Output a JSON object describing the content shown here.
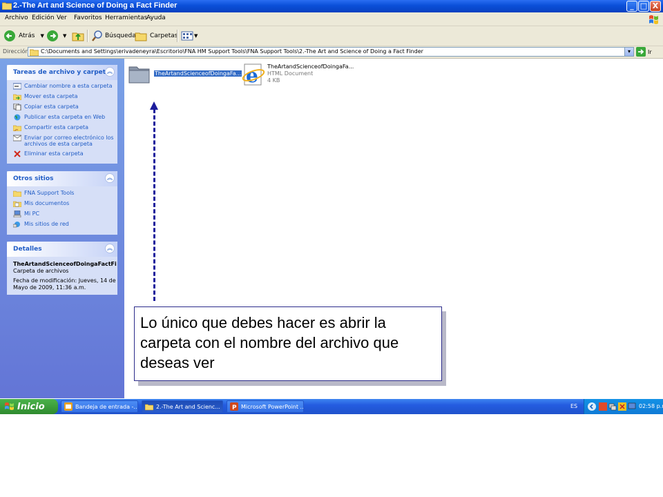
{
  "window": {
    "title": "2.-The Art and Science of Doing a Fact Finder",
    "minimize": "_",
    "maximize": "□",
    "close": "X"
  },
  "menu": [
    "Archivo",
    "Edición",
    "Ver",
    "Favoritos",
    "Herramientas",
    "Ayuda"
  ],
  "toolbar": {
    "back": "Atrás",
    "search": "Búsqueda",
    "folders": "Carpetas"
  },
  "address": {
    "label": "Dirección",
    "path": "C:\\Documents and Settings\\erivadeneyra\\Escritorio\\FNA HM Support Tools\\FNA Support Tools\\2.-The Art and Science of Doing a Fact Finder",
    "go": "Ir"
  },
  "sidebar": {
    "tasks": {
      "title": "Tareas de archivo y carpeta",
      "items": [
        {
          "label": "Cambiar nombre a esta carpeta",
          "icon": "rename-icon"
        },
        {
          "label": "Mover esta carpeta",
          "icon": "move-icon"
        },
        {
          "label": "Copiar esta carpeta",
          "icon": "copy-icon"
        },
        {
          "label": "Publicar esta carpeta en Web",
          "icon": "globe-icon"
        },
        {
          "label": "Compartir esta carpeta",
          "icon": "share-icon"
        },
        {
          "label": "Enviar por correo electrónico los",
          "label2": "archivos de esta carpeta",
          "icon": "mail-icon"
        },
        {
          "label": "Eliminar esta carpeta",
          "icon": "delete-icon"
        }
      ]
    },
    "places": {
      "title": "Otros sitios",
      "items": [
        {
          "label": "FNA Support Tools",
          "icon": "folder-icon"
        },
        {
          "label": "Mis documentos",
          "icon": "documents-icon"
        },
        {
          "label": "Mi PC",
          "icon": "computer-icon"
        },
        {
          "label": "Mis sitios de red",
          "icon": "network-icon"
        }
      ]
    },
    "details": {
      "title": "Detalles",
      "name": "TheArtandScienceofDoingaFactFi",
      "type": "Carpeta de archivos",
      "modified_1": "Fecha de modificación: Jueves, 14 de",
      "modified_2": "Mayo de 2009, 11:36 a.m."
    }
  },
  "files": {
    "folder": {
      "name": "TheArtandScienceofDoingaFa..."
    },
    "html": {
      "name": "TheArtandScienceofDoingaFa...",
      "type": "HTML Document",
      "size": "4 KB"
    }
  },
  "callout": {
    "text": "Lo único que debes hacer es abrir la carpeta con el nombre del archivo que deseas ver"
  },
  "taskbar": {
    "start": "Inicio",
    "tasks": [
      {
        "label": "Bandeja de entrada -..."
      },
      {
        "label": "2.-The Art and Scienc..."
      },
      {
        "label": "Microsoft PowerPoint ..."
      }
    ],
    "lang": "ES",
    "clock": "02:58 p.m."
  }
}
